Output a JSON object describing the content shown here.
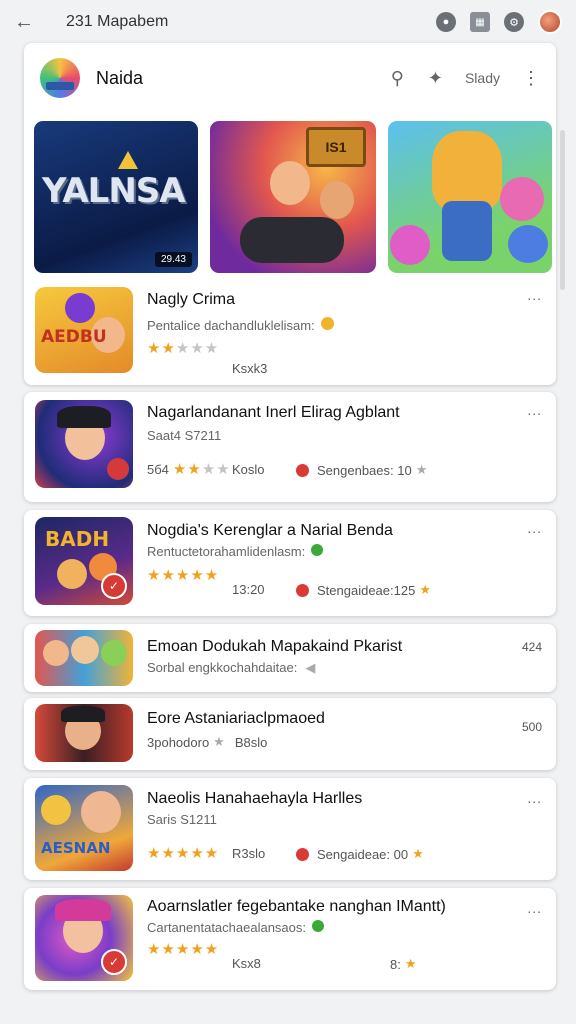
{
  "topbar": {
    "title": "231 Mapabem",
    "back_icon": "arrow-left-icon",
    "icons": [
      "moon-icon",
      "grid-icon",
      "gear-icon",
      "avatar"
    ]
  },
  "app": {
    "title": "Naida",
    "action_text": "Slady"
  },
  "banners": [
    {
      "text": "YALNSA",
      "tag": "29.43"
    },
    {
      "text": "IS1"
    },
    {
      "text": ""
    }
  ],
  "items": [
    {
      "title": "Nagly Crima",
      "subtitle": "Pentalice dachandluklelisam:",
      "thumb_text": "AEDBU",
      "rating_label": "",
      "stars": 2,
      "downloads": "Ksxk3",
      "security": "",
      "right": "..."
    },
    {
      "title": "Nagarlandanant Inerl Elirag Agblant",
      "subtitle": "Saat4 S7211",
      "thumb_text": "",
      "rating_label": "5б4",
      "stars": 2,
      "downloads": "Koslo",
      "security": "Sengenbaes: 10",
      "right": "..."
    },
    {
      "title": "Nogdia's Kerenglar a Narial Benda",
      "subtitle": "Rentuctetorahamlidenlasm:",
      "thumb_text": "BADH",
      "rating_label": "",
      "stars": 5,
      "downloads": "13:20",
      "security": "Stengaideae:125",
      "right": "..."
    },
    {
      "title": "Emoan Dodukah Mapakaind Pkarist",
      "subtitle": "Sorbal engkkochahdaitae:",
      "thumb_text": "",
      "rating_label": "",
      "stars": 0,
      "downloads": "",
      "security": "",
      "right": "424"
    },
    {
      "title": "Eore Astaniariaclpmaoed",
      "subtitle": "3pohodoro",
      "thumb_text": "",
      "rating_label": "",
      "stars": 0,
      "downloads": "B8slo",
      "security": "",
      "right": "500"
    },
    {
      "title": "Naeolis Hanahaehayla Harlles",
      "subtitle": "Saris S1211",
      "thumb_text": "AESNAN",
      "rating_label": "",
      "stars": 5,
      "downloads": "R3slo",
      "security": "Sengaideae: 00",
      "right": "..."
    },
    {
      "title": "Aoarnslatler fegebantake nanghan IMantt)",
      "subtitle": "Cartanentatachaealansaos:",
      "thumb_text": "",
      "rating_label": "",
      "stars": 5,
      "downloads": "Ksx8",
      "security": "8:",
      "right": "..."
    }
  ],
  "colors": {
    "accent_star": "#f0a21d",
    "warning": "#d83a36",
    "ok": "#3ca83a"
  }
}
